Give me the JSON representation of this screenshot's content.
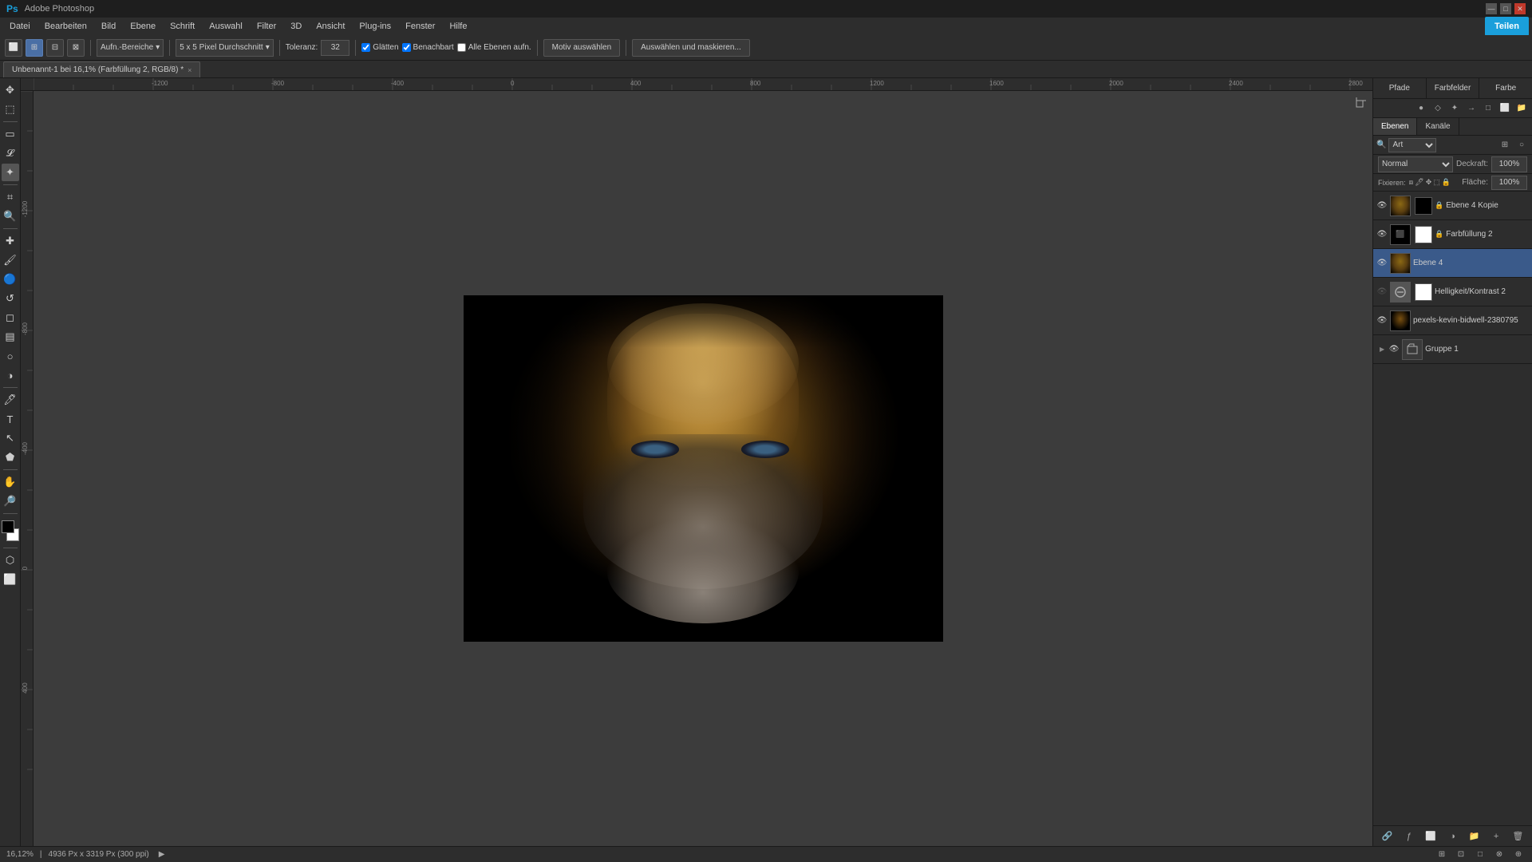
{
  "titlebar": {
    "app_name": "Adobe Photoshop",
    "controls": [
      "—",
      "□",
      "✕"
    ]
  },
  "menubar": {
    "items": [
      "Datei",
      "Bearbeiten",
      "Bild",
      "Ebene",
      "Schrift",
      "Auswahl",
      "Filter",
      "3D",
      "Ansicht",
      "Plug-ins",
      "Fenster",
      "Hilfe"
    ]
  },
  "toolbar": {
    "aufn_bereiche_label": "Aufn.-Bereiche",
    "brush_size_label": "5 x 5 Pixel Durchschnitt",
    "toleranz_label": "Toleranz:",
    "toleranz_value": "32",
    "glatten_label": "Glätten",
    "benachbart_label": "Benachbart",
    "alle_ebenen_label": "Alle Ebenen aufn.",
    "motiv_auswaehlen_label": "Motiv auswählen",
    "auswaehlen_maskieren_label": "Auswählen und maskieren...",
    "share_label": "Teilen"
  },
  "tab": {
    "title": "Unbenannt-1 bei 16,1% (Farbfüllung 2, RGB/8) *",
    "close": "×"
  },
  "canvas": {
    "zoom": "16,12%",
    "dimensions": "4936 Px x 3319 Px (300 ppi)"
  },
  "right_panel": {
    "top_tabs": [
      "Pfade",
      "Farbfelder",
      "Farbe"
    ],
    "layers_tabs": [
      "Ebenen",
      "Kanäle"
    ],
    "search_placeholder": "Art",
    "blend_mode": "Normal",
    "opacity_label": "Deckraft:",
    "opacity_value": "100%",
    "fill_label": "Fläche:",
    "fill_value": "100%",
    "fix_label": "Fixieren:",
    "layers": [
      {
        "name": "Ebene 4 Kopie",
        "visible": true,
        "locked": true,
        "has_mask": true,
        "thumb_type": "face",
        "mask_type": "black"
      },
      {
        "name": "Farbfüllung 2",
        "visible": true,
        "locked": true,
        "has_mask": true,
        "thumb_type": "black",
        "mask_type": "white"
      },
      {
        "name": "Ebene 4",
        "visible": true,
        "locked": false,
        "has_mask": false,
        "thumb_type": "face",
        "mask_type": ""
      },
      {
        "name": "Helligkeit/Kontrast 2",
        "visible": false,
        "locked": false,
        "has_mask": true,
        "thumb_type": "gray",
        "mask_type": "white"
      },
      {
        "name": "pexels-kevin-bidwell-2380795",
        "visible": true,
        "locked": false,
        "has_mask": false,
        "thumb_type": "portrait",
        "mask_type": ""
      },
      {
        "name": "Gruppe 1",
        "visible": true,
        "locked": false,
        "has_mask": false,
        "thumb_type": "group",
        "mask_type": ""
      }
    ]
  },
  "statusbar": {
    "zoom": "16,12%",
    "dimensions": "4936 Px x 3319 Px (300 ppi)",
    "arrow": "▶"
  }
}
